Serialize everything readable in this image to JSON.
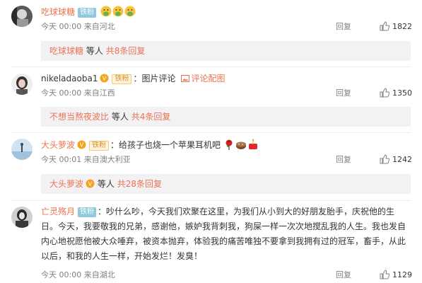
{
  "comments": [
    {
      "username": "吃球球糖",
      "badge": "铁粉",
      "meta": "今天 00:00 来自河北",
      "reply_label": "回复",
      "likes": "1822",
      "sub_user": "吃球球糖",
      "sub_mid": "等人",
      "sub_link": "共8条回复"
    },
    {
      "username": "nikeladaoba1",
      "badge": "铁粉",
      "text": "图片评论",
      "link": "评论配图",
      "meta": "今天 00:00 来自江西",
      "reply_label": "回复",
      "likes": "1350",
      "sub_user": "不想当熬夜波比",
      "sub_mid": "等人",
      "sub_link": "共4条回复"
    },
    {
      "username": "大头萝波",
      "badge": "铁粉",
      "text": "给孩子也烧一个苹果耳机吧",
      "meta": "今天 00:01 来自澳大利亚",
      "reply_label": "回复",
      "likes": "1242",
      "sub_user": "大头萝波",
      "sub_mid": "等人",
      "sub_link": "共28条回复"
    },
    {
      "username": "亡灵殇月",
      "badge": "铁粉",
      "text": "吵什么吵，今天我们欢聚在这里，为我们从小到大的好朋友胎手，庆祝他的生日。今天，我要敬我的兄弟，感谢他，嫉妒我背刺我，狗屎一样一次次地搅乱我的人生。我也发自内心地祝愿他被大众唾弃，被资本抛弃，体验我的痛苦唯独不要拿到我拥有过的冠军，畜手，从此以后，和我的人生一样，开始发烂！发臭！",
      "meta": "今天 00:00 来自湖北",
      "reply_label": "回复",
      "likes": "1129"
    }
  ],
  "colors": {
    "username": "#eb7350",
    "meta": "#808080",
    "subbox_bg": "#f2f2f5",
    "badge_teal": "#8fc9dd"
  }
}
